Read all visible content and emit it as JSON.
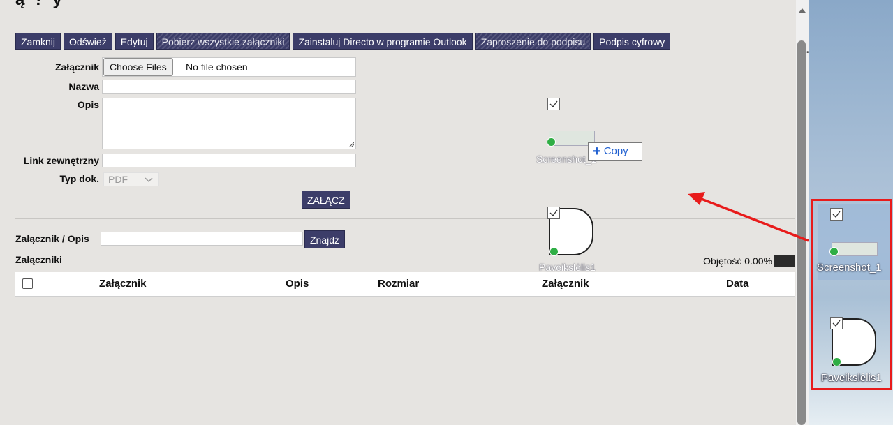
{
  "app": {
    "title_partial": "ą   ?         y",
    "toolbar": [
      {
        "label": "Zamknij",
        "style": "normal"
      },
      {
        "label": "Odśwież",
        "style": "normal"
      },
      {
        "label": "Edytuj",
        "style": "normal"
      },
      {
        "label": "Pobierz wszystkie załączniki",
        "style": "hatched"
      },
      {
        "label": "Zainstaluj Directo w programie Outlook",
        "style": "normal"
      },
      {
        "label": "Zaproszenie do podpisu",
        "style": "hatched"
      },
      {
        "label": "Podpis cyfrowy",
        "style": "normal"
      }
    ],
    "form": {
      "attachment_label": "Załącznik",
      "choose_files_label": "Choose Files",
      "file_status": "No file chosen",
      "name_label": "Nazwa",
      "name_value": "",
      "description_label": "Opis",
      "description_value": "",
      "external_link_label": "Link zewnętrzny",
      "external_link_value": "",
      "doc_type_label": "Typ dok.",
      "doc_type_value": "PDF",
      "attach_button": "ZAŁĄCZ"
    },
    "search": {
      "label": "Załącznik / Opis",
      "value": "",
      "find_button": "Znajdź"
    },
    "attachments": {
      "heading": "Załączniki",
      "volume_text": "Objętość 0.00%",
      "columns": [
        "Załącznik",
        "Opis",
        "Rozmiar",
        "Załącznik",
        "Data"
      ]
    }
  },
  "drag": {
    "ghost_files": [
      "Screenshot_1",
      "Paveikslėlis1"
    ],
    "copy_tooltip": "Copy"
  },
  "desktop": {
    "files": [
      {
        "name": "Screenshot_1",
        "selected": true
      },
      {
        "name": "Paveikslėlis1",
        "selected": true
      }
    ]
  },
  "colors": {
    "toolbar_button": "#3c3d69",
    "annotation_red": "#e81b1b",
    "copy_blue": "#1f5fd0"
  }
}
